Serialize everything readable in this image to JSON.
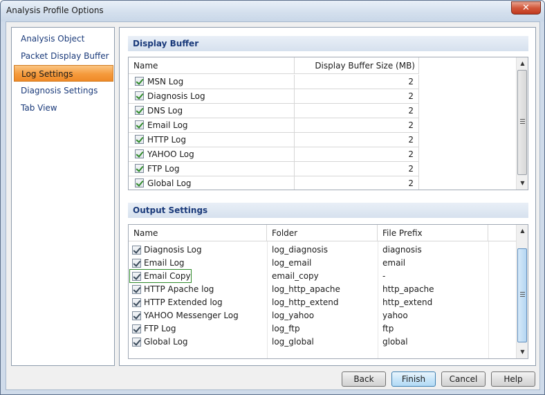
{
  "window": {
    "title": "Analysis Profile Options",
    "close_glyph": "✕"
  },
  "nav": {
    "items": [
      {
        "label": "Analysis Object"
      },
      {
        "label": "Packet Display Buffer"
      },
      {
        "label": "Log Settings",
        "active": true
      },
      {
        "label": "Diagnosis Settings"
      },
      {
        "label": "Tab View"
      }
    ]
  },
  "display_buffer": {
    "title": "Display Buffer",
    "columns": {
      "name": "Name",
      "size": "Display Buffer Size (MB)"
    },
    "rows": [
      {
        "name": "MSN Log",
        "size": "2",
        "checked": true
      },
      {
        "name": "Diagnosis Log",
        "size": "2",
        "checked": true
      },
      {
        "name": "DNS Log",
        "size": "2",
        "checked": true
      },
      {
        "name": "Email Log",
        "size": "2",
        "checked": true
      },
      {
        "name": "HTTP Log",
        "size": "2",
        "checked": true
      },
      {
        "name": "YAHOO Log",
        "size": "2",
        "checked": true
      },
      {
        "name": "FTP Log",
        "size": "2",
        "checked": true
      },
      {
        "name": "Global Log",
        "size": "2",
        "checked": true
      }
    ]
  },
  "output_settings": {
    "title": "Output Settings",
    "columns": {
      "name": "Name",
      "folder": "Folder",
      "prefix": "File Prefix"
    },
    "rows": [
      {
        "name": "Diagnosis Log",
        "folder": "log_diagnosis",
        "prefix": "diagnosis",
        "checked": true
      },
      {
        "name": "Email Log",
        "folder": "log_email",
        "prefix": "email",
        "checked": true
      },
      {
        "name": "Email Copy",
        "folder": "email_copy",
        "prefix": "-",
        "checked": true,
        "focused": true
      },
      {
        "name": "HTTP Apache log",
        "folder": "log_http_apache",
        "prefix": "http_apache",
        "checked": true
      },
      {
        "name": "HTTP Extended log",
        "folder": "log_http_extend",
        "prefix": "http_extend",
        "checked": true
      },
      {
        "name": "YAHOO Messenger Log",
        "folder": "log_yahoo",
        "prefix": "yahoo",
        "checked": true
      },
      {
        "name": "FTP Log",
        "folder": "log_ftp",
        "prefix": "ftp",
        "checked": true
      },
      {
        "name": "Global Log",
        "folder": "log_global",
        "prefix": "global",
        "checked": true
      }
    ]
  },
  "buttons": {
    "back": "Back",
    "finish": "Finish",
    "cancel": "Cancel",
    "help": "Help"
  },
  "scroll_arrows": {
    "up": "▲",
    "down": "▼"
  },
  "colors": {
    "accent": "#f59a3c",
    "title_blue": "#1a3a7a",
    "check_green": "#2f8a2a"
  }
}
